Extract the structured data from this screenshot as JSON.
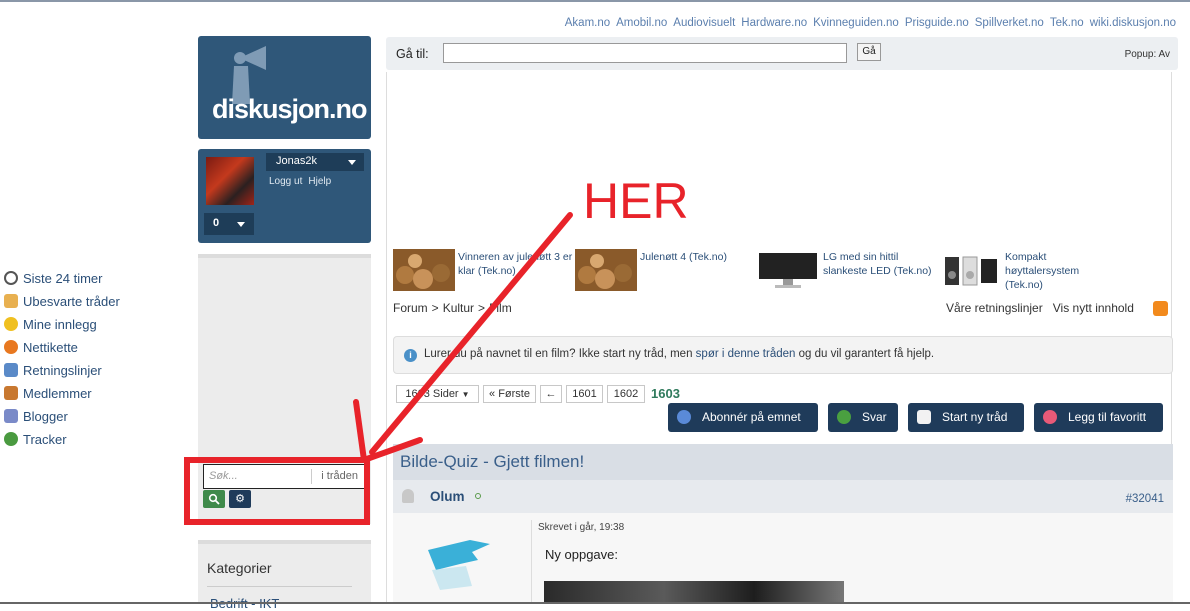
{
  "top_links": [
    "Akam.no",
    "Amobil.no",
    "Audiovisuelt",
    "Hardware.no",
    "Kvinneguiden.no",
    "Prisguide.no",
    "Spillverket.no",
    "Tek.no",
    "wiki.diskusjon.no"
  ],
  "logo": {
    "text": "diskusjon.no"
  },
  "user": {
    "name": "Jonas2k",
    "logout": "Logg ut",
    "help": "Hjelp",
    "notifications": "0"
  },
  "nav": [
    {
      "label": "Siste 24 timer",
      "icon": "clock-icon",
      "color": "#6a6a6a"
    },
    {
      "label": "Ubesvarte tråder",
      "icon": "envelope-icon",
      "color": "#e0a040"
    },
    {
      "label": "Mine innlegg",
      "icon": "smiley-icon",
      "color": "#f0c020"
    },
    {
      "label": "Nettikette",
      "icon": "warning-icon",
      "color": "#e87820"
    },
    {
      "label": "Retningslinjer",
      "icon": "document-icon",
      "color": "#5a8ac8"
    },
    {
      "label": "Medlemmer",
      "icon": "members-icon",
      "color": "#c87830"
    },
    {
      "label": "Blogger",
      "icon": "blog-icon",
      "color": "#7a8ac8"
    },
    {
      "label": "Tracker",
      "icon": "bug-icon",
      "color": "#4a9a40"
    }
  ],
  "search": {
    "placeholder": "Søk...",
    "scope": "i tråden"
  },
  "categories": {
    "title": "Kategorier",
    "first": "Bedrift - IKT"
  },
  "goto": {
    "label": "Gå til:",
    "button": "Gå",
    "popup": "Popup: Av"
  },
  "news": [
    {
      "title": "Vinneren av julenøtt 3 er klar (Tek.no)",
      "thumb": "nuts"
    },
    {
      "title": "Julenøtt 4 (Tek.no)",
      "thumb": "nuts"
    },
    {
      "title": "LG med sin hittil slankeste LED (Tek.no)",
      "thumb": "monitor"
    },
    {
      "title": "Kompakt høyttalersystem (Tek.no)",
      "thumb": "speakers"
    }
  ],
  "breadcrumb": [
    "Forum",
    ">",
    "Kultur",
    ">",
    "Film"
  ],
  "right_links": {
    "guidelines": "Våre retningslinjer",
    "new_content": "Vis nytt innhold"
  },
  "notice": {
    "pre": "Lurer du på navnet til en film? Ikke start ny tråd, men ",
    "link": "spør i denne tråden",
    "post": " og du vil garantert få hjelp."
  },
  "pagination": {
    "pages_label": "1603 Sider",
    "first": "« Første",
    "prev": "←",
    "p1": "1601",
    "p2": "1602",
    "current": "1603"
  },
  "actions": {
    "subscribe": "Abonnér på emnet",
    "reply": "Svar",
    "new_thread": "Start ny tråd",
    "favorite": "Legg til favoritt"
  },
  "thread": {
    "title": "Bilde-Quiz - Gjett filmen!"
  },
  "post": {
    "author": "Olum",
    "number": "#32041",
    "written": "Skrevet i går, 19:38",
    "text": "Ny oppgave:"
  },
  "annotation": {
    "text": "HER",
    "color": "#e8232a"
  }
}
